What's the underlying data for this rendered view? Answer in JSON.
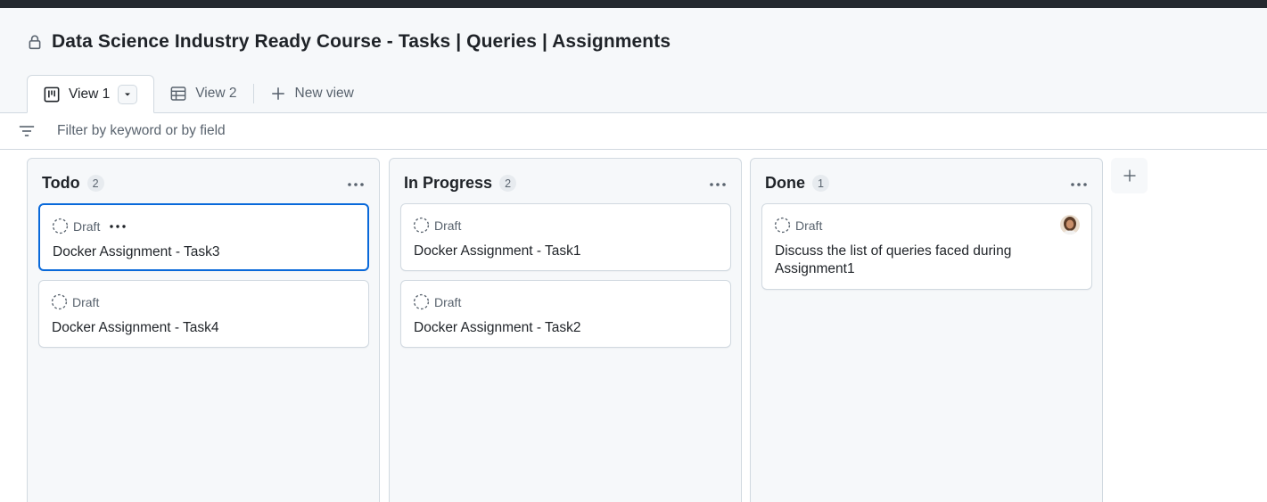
{
  "project": {
    "title": "Data Science Industry Ready Course - Tasks | Queries | Assignments"
  },
  "tabs": {
    "view1": "View 1",
    "view2": "View 2",
    "new_view": "New view"
  },
  "filter": {
    "placeholder": "Filter by keyword or by field"
  },
  "columns": [
    {
      "title": "Todo",
      "count": "2",
      "cards": [
        {
          "status": "Draft",
          "title": "Docker Assignment - Task3"
        },
        {
          "status": "Draft",
          "title": "Docker Assignment - Task4"
        }
      ]
    },
    {
      "title": "In Progress",
      "count": "2",
      "cards": [
        {
          "status": "Draft",
          "title": "Docker Assignment - Task1"
        },
        {
          "status": "Draft",
          "title": "Docker Assignment - Task2"
        }
      ]
    },
    {
      "title": "Done",
      "count": "1",
      "cards": [
        {
          "status": "Draft",
          "title": "Discuss the list of queries faced during Assignment1"
        }
      ]
    }
  ],
  "icons": [
    "lock-icon",
    "board-icon",
    "table-icon",
    "plus-icon",
    "filter-icon",
    "kebab-icon",
    "draft-icon",
    "chevron-down-icon",
    "avatar"
  ],
  "colors": {
    "accent": "#0969da",
    "border": "#d1d9e0",
    "topbar": "#24292f"
  }
}
